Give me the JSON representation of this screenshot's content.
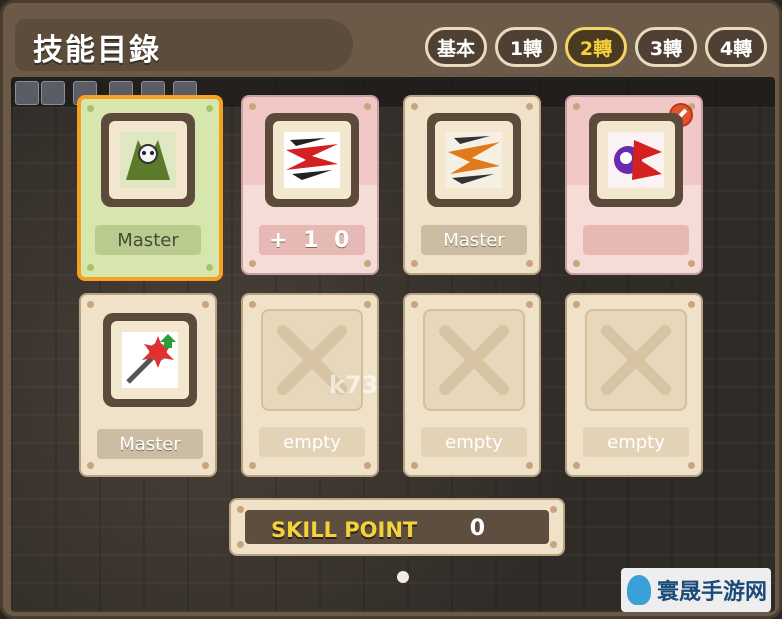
{
  "window": {
    "title": "技能目錄"
  },
  "tabs": [
    {
      "label": "基本",
      "active": false
    },
    {
      "label": "1轉",
      "active": false
    },
    {
      "label": "2轉",
      "active": true
    },
    {
      "label": "3轉",
      "active": false
    },
    {
      "label": "4轉",
      "active": false
    }
  ],
  "skills": [
    {
      "icon": "skull-wings-skill-icon",
      "label": "Master",
      "style": "green"
    },
    {
      "icon": "red-slash-skill-icon",
      "label": "+ 1 0",
      "style": "pink"
    },
    {
      "icon": "orange-slash-skill-icon",
      "label": "Master",
      "style": "beige"
    },
    {
      "icon": "purple-burst-skill-icon",
      "label": "",
      "style": "pink",
      "disabled": true
    },
    {
      "icon": "spiked-mace-skill-icon",
      "label": "Master",
      "style": "beige"
    },
    {
      "icon": "empty-slot-icon",
      "label": "empty",
      "style": "empty"
    },
    {
      "icon": "empty-slot-icon",
      "label": "empty",
      "style": "empty"
    },
    {
      "icon": "empty-slot-icon",
      "label": "empty",
      "style": "empty"
    }
  ],
  "skill_point": {
    "label": "SKILL POINT",
    "value": "0"
  },
  "watermark": {
    "site": "k73",
    "brand": "寰晟手游网"
  },
  "colors": {
    "active_tab": "#f5cf3c",
    "selected_border": "#f5a020",
    "frame": "#6b5a47"
  }
}
